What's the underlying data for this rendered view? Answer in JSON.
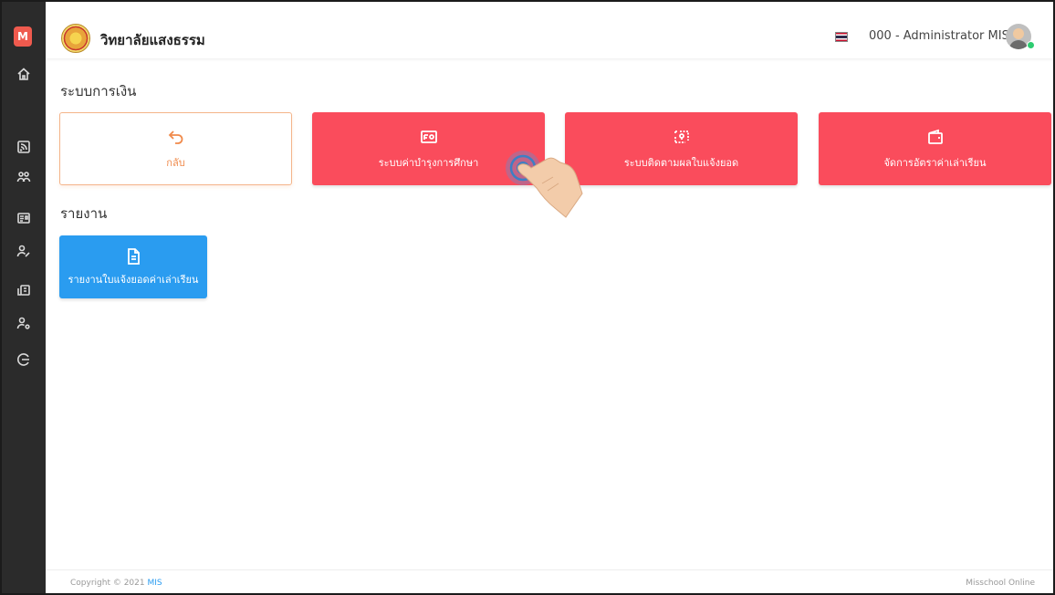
{
  "app": {
    "logo_letter": "M",
    "school_name": "วิทยาลัยแสงธรรม",
    "user_name": "000 - Administrator MIS"
  },
  "sidebar": {
    "items": [
      {
        "icon": "home-icon"
      },
      {
        "icon": "rss-icon"
      },
      {
        "icon": "users-icon"
      },
      {
        "icon": "id-card-icon"
      },
      {
        "icon": "user-edit-icon"
      },
      {
        "icon": "money-icon"
      },
      {
        "icon": "user-settings-icon"
      },
      {
        "icon": "logout-icon"
      }
    ]
  },
  "finance": {
    "title": "ระบบการเงิน",
    "tiles": [
      {
        "label": "กลับ",
        "icon": "back-arrow-icon"
      },
      {
        "label": "ระบบค่าบำรุงการศึกษา",
        "icon": "cash-icon"
      },
      {
        "label": "ระบบติดตามผลใบแจ้งยอด",
        "icon": "tracking-icon"
      },
      {
        "label": "จัดการอัตราค่าเล่าเรียน",
        "icon": "wallet-icon"
      }
    ]
  },
  "report": {
    "title": "รายงาน",
    "tiles": [
      {
        "label": "รายงานใบแจ้งยอดค่าเล่าเรียน",
        "icon": "document-icon"
      }
    ]
  },
  "footer": {
    "copyright": "Copyright © 2021 ",
    "brand": "MIS",
    "right": "Misschool Online"
  },
  "colors": {
    "sidebar": "#2b2b2b",
    "tile_red": "#fa4c5c",
    "tile_blue": "#2a9cf0",
    "back_accent": "#f08a4b"
  }
}
